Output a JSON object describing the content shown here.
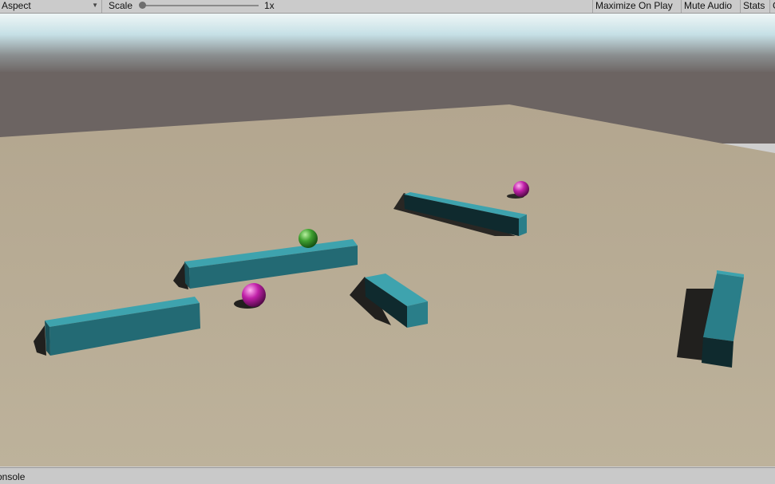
{
  "toolbar": {
    "aspect_label": "Aspect",
    "scale_label": "Scale",
    "scale_value": "1x",
    "scale_fraction": 0,
    "maximize_on_play": "Maximize On Play",
    "mute_audio": "Mute Audio",
    "stats": "Stats",
    "gizmos": "Gizmos"
  },
  "scene": {
    "sky_top_color": "#c6e0e6",
    "horizon_color": "#6c6462",
    "ground_color": "#b9ad95",
    "wall_color": "#2b7b86",
    "player_color": "#3fa030",
    "enemy_color": "#c020a8"
  },
  "statusbar": {
    "console_tab": "onsole"
  }
}
